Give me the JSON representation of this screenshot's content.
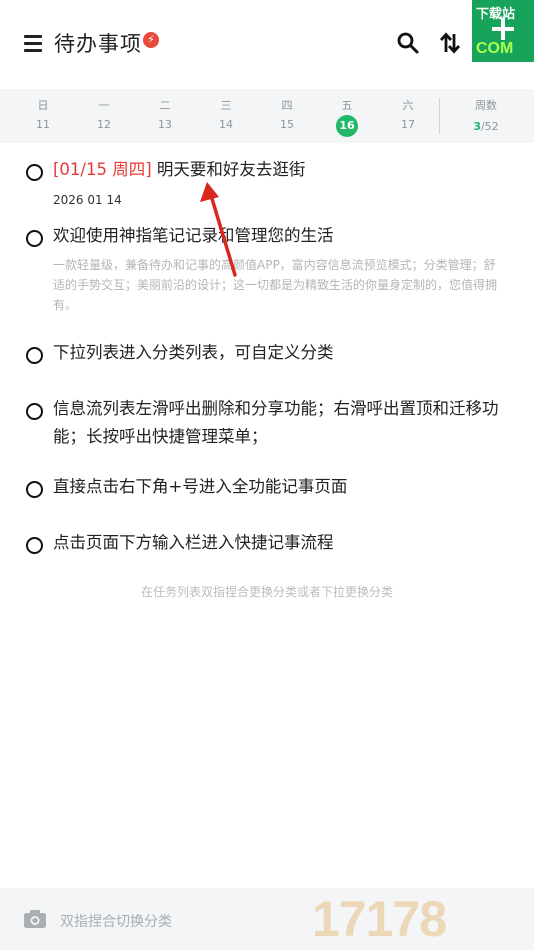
{
  "header": {
    "title": "待办事项",
    "badge": "⚡"
  },
  "calendar": {
    "days": [
      {
        "weekday": "日",
        "date": "11"
      },
      {
        "weekday": "一",
        "date": "12"
      },
      {
        "weekday": "二",
        "date": "13"
      },
      {
        "weekday": "三",
        "date": "14"
      },
      {
        "weekday": "四",
        "date": "15"
      },
      {
        "weekday": "五",
        "date": "16"
      },
      {
        "weekday": "六",
        "date": "17"
      }
    ],
    "week_label": "周数",
    "week_current": "3",
    "week_total": "/52",
    "accent": "#21b86a"
  },
  "tasks": [
    {
      "tag": "[01/15 周四]",
      "title": "明天要和好友去逛街",
      "date": "2026 01 14"
    },
    {
      "title": "欢迎使用神指笔记记录和管理您的生活",
      "desc": "一款轻量级，兼备待办和记事的高颜值APP，富内容信息流预览模式；分类管理；舒适的手势交互；美丽前沿的设计；这一切都是为精致生活的你量身定制的，您值得拥有。"
    },
    {
      "title": "下拉列表进入分类列表，可自定义分类"
    },
    {
      "title": "信息流列表左滑呼出删除和分享功能；右滑呼出置顶和迁移功能；长按呼出快捷管理菜单；"
    },
    {
      "title": "直接点击右下角+号进入全功能记事页面"
    },
    {
      "title": "点击页面下方输入栏进入快捷记事流程"
    }
  ],
  "hint": "在任务列表双指捏合更换分类或者下拉更换分类",
  "bottom": {
    "placeholder": "双指捏合切换分类",
    "accent": "#17a35a"
  },
  "watermark": {
    "number": "17178",
    "label": "下载站",
    "suffix": "COM"
  }
}
